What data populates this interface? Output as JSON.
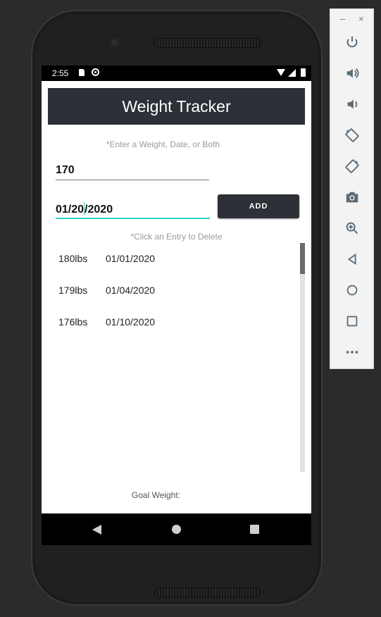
{
  "status_bar": {
    "time": "2:55"
  },
  "app": {
    "title": "Weight Tracker",
    "hint_top": "*Enter a Weight, Date, or Both",
    "weight_value": "170",
    "date_value_part1": "01/20",
    "date_value_part2": "2020",
    "add_label": "ADD",
    "hint_delete": "*Click an Entry to Delete",
    "entries": [
      {
        "weight": "180lbs",
        "date": "01/01/2020"
      },
      {
        "weight": "179lbs",
        "date": "01/04/2020"
      },
      {
        "weight": "176lbs",
        "date": "01/10/2020"
      }
    ],
    "goal_label": "Goal Weight:"
  },
  "emulator_toolbar": {
    "minimize": "–",
    "close": "×",
    "tools": [
      "power-icon",
      "volume-up-icon",
      "volume-down-icon",
      "rotate-left-icon",
      "rotate-right-icon",
      "camera-icon",
      "zoom-icon",
      "back-icon",
      "home-icon",
      "overview-icon",
      "more-icon"
    ]
  },
  "colors": {
    "accent": "#2ed3c6",
    "appbar": "#2d3036",
    "toolbar_icon": "#5b6c79"
  }
}
